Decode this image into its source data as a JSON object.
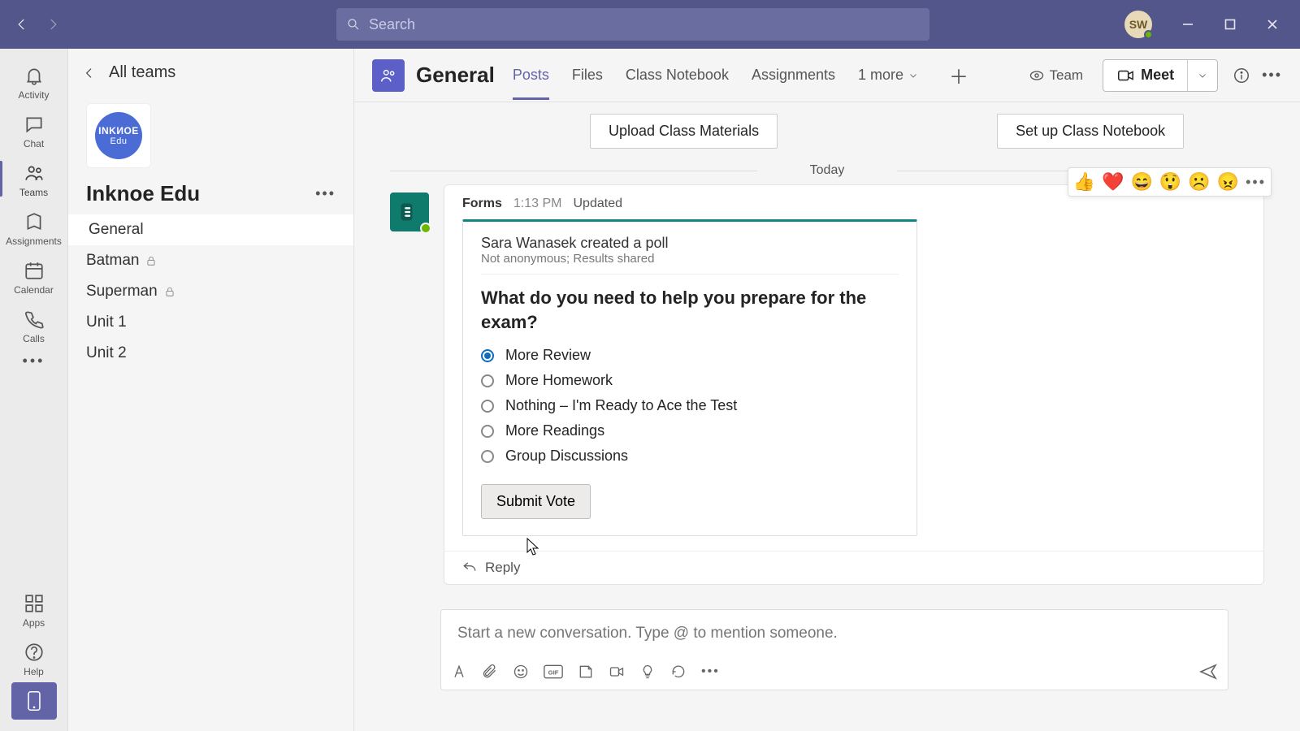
{
  "search": {
    "placeholder": "Search"
  },
  "user_initials": "SW",
  "rail": {
    "items": [
      {
        "label": "Activity"
      },
      {
        "label": "Chat"
      },
      {
        "label": "Teams"
      },
      {
        "label": "Assignments"
      },
      {
        "label": "Calendar"
      },
      {
        "label": "Calls"
      }
    ],
    "apps": "Apps",
    "help": "Help"
  },
  "sidebar": {
    "all_teams": "All teams",
    "team_name": "Inknoe Edu",
    "team_logo_top": "INKИOE",
    "team_logo_bottom": "Edu",
    "channels": [
      {
        "name": "General",
        "locked": false
      },
      {
        "name": "Batman",
        "locked": true
      },
      {
        "name": "Superman",
        "locked": true
      },
      {
        "name": "Unit 1",
        "locked": false
      },
      {
        "name": "Unit 2",
        "locked": false
      }
    ]
  },
  "header": {
    "channel": "General",
    "tabs": [
      "Posts",
      "Files",
      "Class Notebook",
      "Assignments"
    ],
    "more_tab": "1 more",
    "team_label": "Team",
    "meet_label": "Meet"
  },
  "quick": {
    "upload": "Upload Class Materials",
    "setup": "Set up Class Notebook"
  },
  "today": "Today",
  "post": {
    "app": "Forms",
    "time": "1:13 PM",
    "updated": "Updated",
    "creator": "Sara Wanasek created a poll",
    "privacy": "Not anonymous; Results shared",
    "question": "What do you need to help you prepare for the exam?",
    "options": [
      "More Review",
      "More Homework",
      "Nothing – I'm Ready to Ace the Test",
      "More Readings",
      "Group Discussions"
    ],
    "submit": "Submit Vote",
    "reply": "Reply",
    "reactions": [
      "👍",
      "❤️",
      "😄",
      "😲",
      "☹️",
      "😠"
    ]
  },
  "composer": {
    "placeholder": "Start a new conversation. Type @ to mention someone."
  }
}
